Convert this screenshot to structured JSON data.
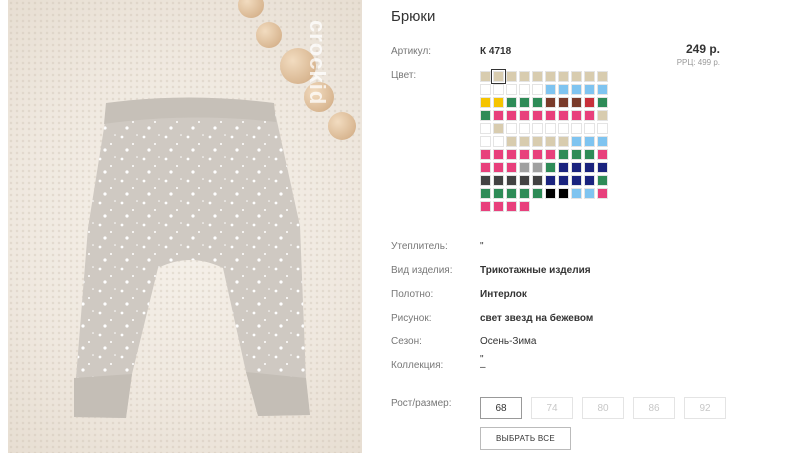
{
  "product": {
    "title": "Брюки",
    "article_label": "Артикул:",
    "article_value": "К 4718",
    "price": "249 р.",
    "rrp": "РРЦ: 499 р.",
    "color_label": "Цвет:",
    "watermark": "crockid"
  },
  "colors": {
    "selected_index": 1,
    "swatches": [
      "#d8ccaf",
      "#d8ccaf",
      "#d8ccaf",
      "#d8ccaf",
      "#d8ccaf",
      "#d8ccaf",
      "#d8ccaf",
      "#d8ccaf",
      "#d8ccaf",
      "#d8ccaf",
      "#ffffff",
      "#ffffff",
      "#ffffff",
      "#ffffff",
      "#ffffff",
      "#7fc4f0",
      "#7fc4f0",
      "#7fc4f0",
      "#7fc4f0",
      "#7fc4f0",
      "#f5c400",
      "#f5c400",
      "#2e8b57",
      "#2e8b57",
      "#2e8b57",
      "#7a3b2a",
      "#7a3b2a",
      "#7a3b2a",
      "#c8303a",
      "#2e8b57",
      "#2e8b57",
      "#e8407c",
      "#e8407c",
      "#e8407c",
      "#e8407c",
      "#e8407c",
      "#e8407c",
      "#e8407c",
      "#e8407c",
      "#d8ccaf",
      "#ffffff",
      "#d8ccaf",
      "#ffffff",
      "#ffffff",
      "#ffffff",
      "#ffffff",
      "#ffffff",
      "#ffffff",
      "#ffffff",
      "#ffffff",
      "#ffffff",
      "#ffffff",
      "#d8ccaf",
      "#d8ccaf",
      "#d8ccaf",
      "#d8ccaf",
      "#d8ccaf",
      "#7fc4f0",
      "#7fc4f0",
      "#7fc4f0",
      "#e8407c",
      "#e8407c",
      "#e8407c",
      "#e8407c",
      "#e8407c",
      "#e8407c",
      "#2e8b57",
      "#2e8b57",
      "#2e8b57",
      "#e8407c",
      "#e8407c",
      "#e8407c",
      "#e8407c",
      "#a0a0a0",
      "#a0a0a0",
      "#2e8b57",
      "#1a237e",
      "#1a237e",
      "#1a237e",
      "#1a237e",
      "#424242",
      "#424242",
      "#424242",
      "#424242",
      "#424242",
      "#1a237e",
      "#1a237e",
      "#1a237e",
      "#1a237e",
      "#2e8b57",
      "#2e8b57",
      "#2e8b57",
      "#2e8b57",
      "#2e8b57",
      "#2e8b57",
      "#000000",
      "#000000",
      "#7fc4f0",
      "#7fc4f0",
      "#e8407c",
      "#e8407c",
      "#e8407c",
      "#e8407c",
      "#e8407c"
    ]
  },
  "details": [
    {
      "label": "Утеплитель:",
      "value": "\"",
      "bold": false
    },
    {
      "label": "Вид изделия:",
      "value": "Трикотажные изделия",
      "bold": true
    },
    {
      "label": "Полотно:",
      "value": "Интерлок",
      "bold": true
    },
    {
      "label": "Рисунок:",
      "value": "свет звезд на бежевом",
      "bold": true
    },
    {
      "label": "Сезон:",
      "value": "Осень-Зима",
      "bold": false
    },
    {
      "label": "Коллекция:",
      "value": "\"\n–",
      "bold": false
    }
  ],
  "sizes": {
    "label": "Рост/размер:",
    "options": [
      "68",
      "74",
      "80",
      "86",
      "92"
    ],
    "active_index": 0,
    "select_all_label": "ВЫБРАТЬ ВСЕ"
  }
}
